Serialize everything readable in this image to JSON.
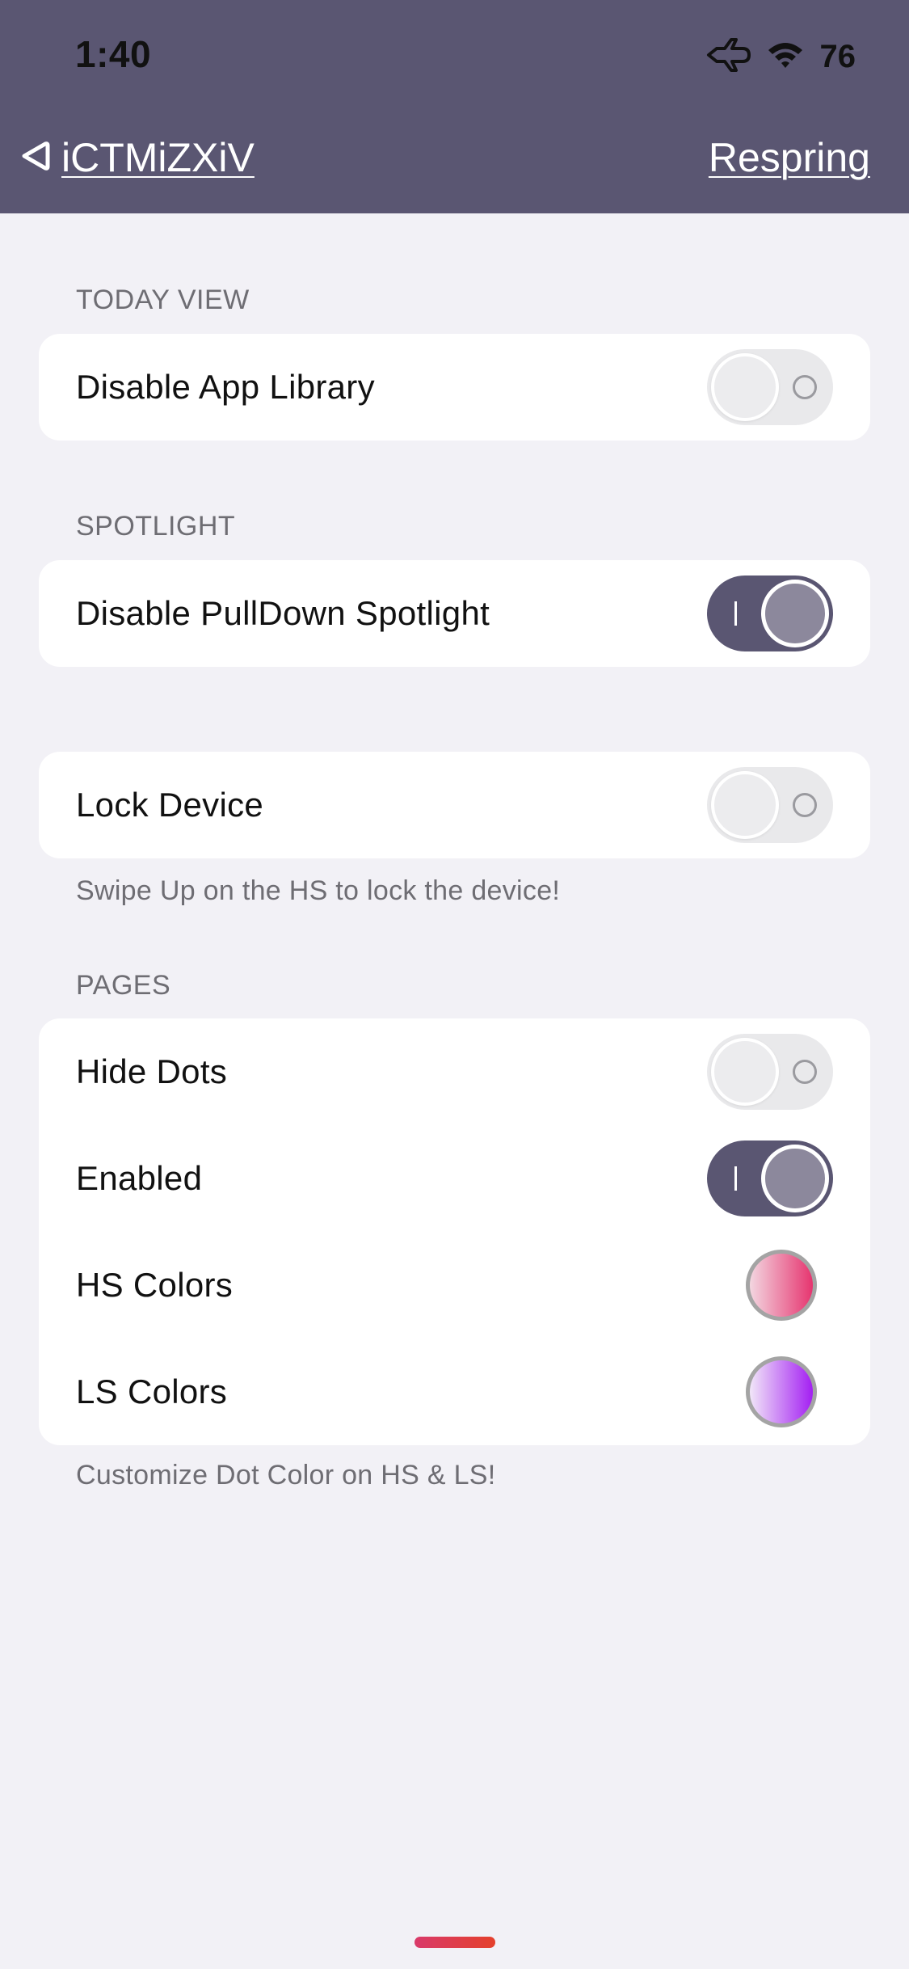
{
  "status_bar": {
    "time": "1:40",
    "airplane_icon": "airplane-icon",
    "wifi_icon": "wifi-icon",
    "battery": "76"
  },
  "nav": {
    "back_icon": "back-triangle-icon",
    "back_title": "iCTMiZXiV",
    "action_label": "Respring"
  },
  "colors": {
    "accent": "#5a5672",
    "background": "#f2f1f6",
    "hs_color_gradient": [
      "#f3d6e0",
      "#e6346f"
    ],
    "ls_color_gradient": [
      "#f1e6f8",
      "#a31ff2"
    ]
  },
  "sections": {
    "today_view": {
      "header": "TODAY VIEW",
      "rows": [
        {
          "label": "Disable App Library",
          "toggle": false
        }
      ]
    },
    "spotlight": {
      "header": "SPOTLIGHT",
      "rows": [
        {
          "label": "Disable PullDown Spotlight",
          "toggle": true
        }
      ]
    },
    "lock": {
      "rows": [
        {
          "label": "Lock Device",
          "toggle": false
        }
      ],
      "footer": "Swipe Up on the HS to lock the device!"
    },
    "pages": {
      "header": "PAGES",
      "rows": [
        {
          "label": "Hide Dots",
          "toggle": false
        },
        {
          "label": "Enabled",
          "toggle": true
        },
        {
          "label": "HS Colors",
          "type": "color"
        },
        {
          "label": "LS Colors",
          "type": "color"
        }
      ],
      "footer": "Customize Dot Color on HS & LS!"
    }
  }
}
